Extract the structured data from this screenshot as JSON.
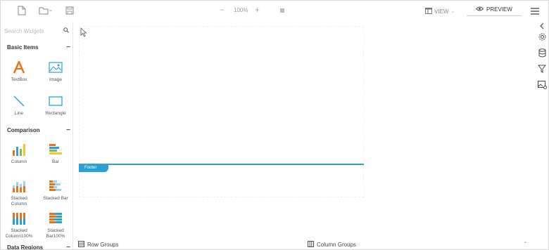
{
  "toolbar": {
    "zoom_level": "100%",
    "zoom_minus": "−",
    "zoom_plus": "+",
    "view_label": "VIEW",
    "preview_label": "PREVIEW"
  },
  "left_panel": {
    "search_placeholder": "Search Widgets",
    "sections": {
      "basic": {
        "title": "Basic Items",
        "items": [
          "TextBox",
          "Image",
          "Line",
          "Rectangle"
        ]
      },
      "comparison": {
        "title": "Comparison",
        "items": [
          "Column",
          "Bar",
          "Stacked Column",
          "Stacked Bar",
          "Stacked Column100%",
          "Stacked Bar100%"
        ]
      },
      "data_regions": {
        "title": "Data Regions"
      }
    }
  },
  "canvas": {
    "footer_label": "Footer"
  },
  "bottom": {
    "row_groups": "Row Groups",
    "column_groups": "Column Groups"
  },
  "colors": {
    "accent": "#2a9fd8",
    "textbox_icon": "#e8731c"
  }
}
